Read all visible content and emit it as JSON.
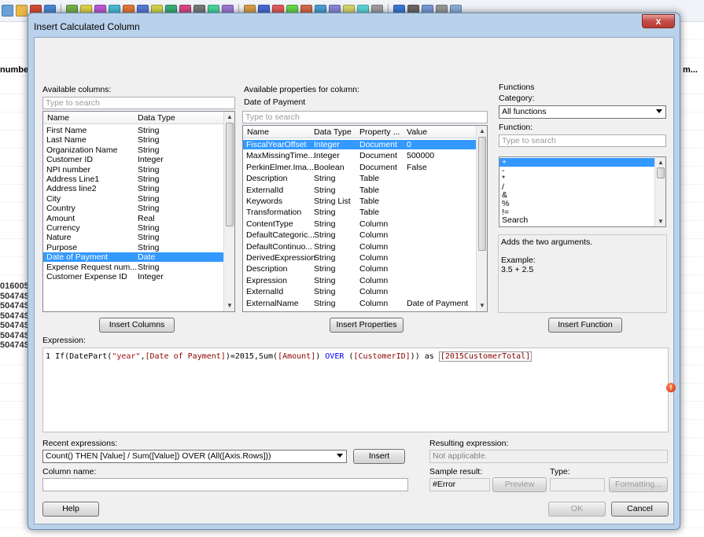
{
  "background": {
    "header_left": "number",
    "header_right": "m...",
    "col_values": [
      "016005",
      "50474S",
      "50474S",
      "50474S",
      "50474S",
      "50474S",
      "50474S"
    ]
  },
  "dialog": {
    "title": "Insert Calculated Column",
    "close_label": "x"
  },
  "available_columns": {
    "label": "Available columns:",
    "search_placeholder": "Type to search",
    "headers": [
      "Name",
      "Data Type"
    ],
    "rows": [
      [
        "First Name",
        "String"
      ],
      [
        "Last Name",
        "String"
      ],
      [
        "Organization Name",
        "String"
      ],
      [
        "Customer ID",
        "Integer"
      ],
      [
        "NPI number",
        "String"
      ],
      [
        "Address Line1",
        "String"
      ],
      [
        "Address line2",
        "String"
      ],
      [
        "City",
        "String"
      ],
      [
        "Country",
        "String"
      ],
      [
        "Amount",
        "Real"
      ],
      [
        "Currency",
        "String"
      ],
      [
        "Nature",
        "String"
      ],
      [
        "Purpose",
        "String"
      ],
      [
        "Date of Payment",
        "Date"
      ],
      [
        "Expense Request num...",
        "String"
      ],
      [
        "Customer Expense ID",
        "Integer"
      ]
    ],
    "selected_index": 13,
    "insert_button": "Insert Columns"
  },
  "available_properties": {
    "label": "Available properties for column:",
    "column_name": "Date of Payment",
    "search_placeholder": "Type to search",
    "headers": [
      "Name",
      "Data Type",
      "Property ...",
      "Value"
    ],
    "rows": [
      [
        "FiscalYearOffset",
        "Integer",
        "Document",
        "0"
      ],
      [
        "MaxMissingTime...",
        "Integer",
        "Document",
        "500000"
      ],
      [
        "PerkinElmer.Ima...",
        "Boolean",
        "Document",
        "False"
      ],
      [
        "Description",
        "String",
        "Table",
        ""
      ],
      [
        "ExternalId",
        "String",
        "Table",
        ""
      ],
      [
        "Keywords",
        "String List",
        "Table",
        ""
      ],
      [
        "Transformation",
        "String",
        "Table",
        ""
      ],
      [
        "ContentType",
        "String",
        "Column",
        ""
      ],
      [
        "DefaultCategoric...",
        "String",
        "Column",
        ""
      ],
      [
        "DefaultContinuo...",
        "String",
        "Column",
        ""
      ],
      [
        "DerivedExpression",
        "String",
        "Column",
        ""
      ],
      [
        "Description",
        "String",
        "Column",
        ""
      ],
      [
        "Expression",
        "String",
        "Column",
        ""
      ],
      [
        "ExternalId",
        "String",
        "Column",
        ""
      ],
      [
        "ExternalName",
        "String",
        "Column",
        "Date of Payment"
      ]
    ],
    "selected_index": 0,
    "insert_button": "Insert Properties"
  },
  "functions": {
    "group_label": "Functions",
    "category_label": "Category:",
    "category_value": "All functions",
    "function_label": "Function:",
    "search_placeholder": "Type to search",
    "items": [
      "+",
      "-",
      "*",
      "/",
      "&",
      "%",
      "!=",
      "Search"
    ],
    "selected_index": 0,
    "description": "Adds the two arguments.",
    "example_label": "Example:",
    "example_value": "3.5 + 2.5",
    "insert_button": "Insert Function"
  },
  "expression": {
    "label": "Expression:",
    "line_number": "1",
    "parts": [
      "If(DatePart(",
      "\"year\"",
      ",",
      "[Date of Payment]",
      ")=2015,Sum(",
      "[Amount]",
      ") ",
      "OVER",
      " (",
      "[CustomerID]",
      "))",
      " as ",
      "[2015CustomerTotal]"
    ]
  },
  "bottom": {
    "recent_label": "Recent expressions:",
    "recent_value": "Count() THEN [Value] / Sum([Value]) OVER (All([Axis.Rows]))",
    "insert_button": "Insert",
    "column_name_label": "Column name:",
    "column_name_value": "",
    "resulting_label": "Resulting expression:",
    "resulting_value": "Not applicable.",
    "sample_label": "Sample result:",
    "sample_value": "#Error",
    "preview_button": "Preview",
    "type_label": "Type:",
    "type_value": "",
    "formatting_button": "Formatting...",
    "help_button": "Help",
    "ok_button": "OK",
    "cancel_button": "Cancel"
  }
}
